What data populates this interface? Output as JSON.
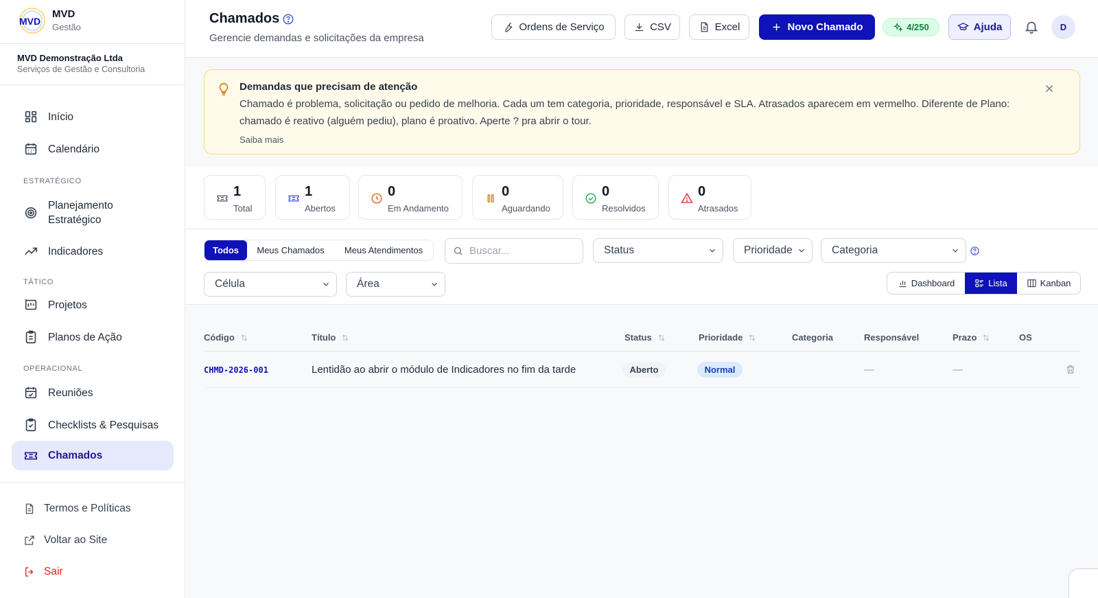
{
  "brand": {
    "logo_text": "MVD",
    "name": "MVD",
    "subtitle": "Gestão"
  },
  "company": {
    "name": "MVD Demonstração Ltda",
    "subtitle": "Serviços de Gestão e Consultoria"
  },
  "sidebar": {
    "items": [
      {
        "label": "Início",
        "icon": "dashboard-grid-icon"
      },
      {
        "label": "Calendário",
        "icon": "calendar-icon"
      },
      {
        "label": "Planejamento Estratégico",
        "icon": "target-icon"
      },
      {
        "label": "Indicadores",
        "icon": "trending-up-icon"
      },
      {
        "label": "Projetos",
        "icon": "project-chart-icon"
      },
      {
        "label": "Planos de Ação",
        "icon": "clipboard-icon"
      },
      {
        "label": "Reuniões",
        "icon": "calendar-check-icon"
      },
      {
        "label": "Checklists & Pesquisas",
        "icon": "clipboard-check-icon"
      },
      {
        "label": "Chamados",
        "icon": "ticket-icon",
        "active": true
      }
    ],
    "sections": {
      "strategic": "Estratégico",
      "tactical": "Tático",
      "operational": "Operacional"
    },
    "footer": [
      {
        "label": "Termos e Políticas",
        "icon": "document-icon"
      },
      {
        "label": "Voltar ao Site",
        "icon": "external-link-icon"
      },
      {
        "label": "Sair",
        "icon": "logout-icon"
      }
    ]
  },
  "header": {
    "title": "Chamados",
    "subtitle": "Gerencie demandas e solicitações da empresa",
    "buttons": {
      "service_orders": "Ordens de Serviço",
      "csv": "CSV",
      "excel": "Excel",
      "new_ticket": "Novo Chamado",
      "help": "Ajuda"
    },
    "credits": "4/250",
    "avatar_initial": "D"
  },
  "alert": {
    "title": "Demandas que precisam de atenção",
    "text": "Chamado é problema, solicitação ou pedido de melhoria. Cada um tem categoria, prioridade, responsável e SLA. Atrasados aparecem em vermelho. Diferente de Plano: chamado é reativo (alguém pediu), plano é proativo. Aperte ? pra abrir o tour.",
    "link": "Saiba mais"
  },
  "stats": [
    {
      "value": "1",
      "label": "Total",
      "icon": "ticket-icon",
      "color": "#4b5563"
    },
    {
      "value": "1",
      "label": "Abertos",
      "icon": "ticket-icon",
      "color": "#3b4bd8"
    },
    {
      "value": "0",
      "label": "Em Andamento",
      "icon": "clock-icon",
      "color": "#ea580c"
    },
    {
      "value": "0",
      "label": "Aguardando",
      "icon": "pause-icon",
      "color": "#d97706"
    },
    {
      "value": "0",
      "label": "Resolvidos",
      "icon": "check-circle-icon",
      "color": "#16a34a"
    },
    {
      "value": "0",
      "label": "Atrasados",
      "icon": "alert-triangle-icon",
      "color": "#dc2626"
    }
  ],
  "filters": {
    "scope_tabs": [
      "Todos",
      "Meus Chamados",
      "Meus Atendimentos"
    ],
    "active_scope": "Todos",
    "search_placeholder": "Buscar...",
    "status": "Status",
    "priority": "Prioridade",
    "category": "Categoria",
    "cell": "Célula",
    "area": "Área",
    "views": [
      "Dashboard",
      "Lista",
      "Kanban"
    ],
    "active_view": "Lista"
  },
  "table": {
    "columns": [
      "Código",
      "Título",
      "Status",
      "Prioridade",
      "Categoria",
      "Responsável",
      "Prazo",
      "OS"
    ],
    "rows": [
      {
        "code": "CHMD-2026-001",
        "title": "Lentidão ao abrir o módulo de Indicadores no fim da tarde",
        "status": "Aberto",
        "priority": "Normal",
        "category": "",
        "assignee": "—",
        "deadline": "—",
        "os": ""
      }
    ]
  },
  "colors": {
    "primary": "#0f12b8",
    "active_nav_bg": "#e6e8fb",
    "alert_bg": "#fffbeb",
    "alert_border": "#fcd980",
    "danger": "#dc2626"
  }
}
